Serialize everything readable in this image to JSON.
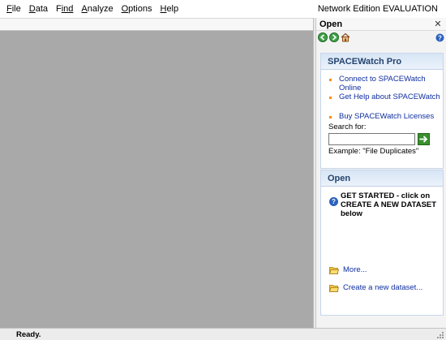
{
  "menubar": {
    "items": [
      {
        "key": "F",
        "rest": "ile"
      },
      {
        "key": "D",
        "rest": "ata"
      },
      {
        "key": "F",
        "rest": "ind"
      },
      {
        "key": "A",
        "rest": "nalyze"
      },
      {
        "key": "O",
        "rest": "ptions"
      },
      {
        "key": "H",
        "rest": "elp"
      }
    ],
    "edition": "Network Edition EVALUATION"
  },
  "panel": {
    "title": "Open",
    "close_glyph": "✕",
    "help_glyph": "?",
    "tools": [
      "back-icon",
      "forward-icon",
      "home-icon",
      "help-icon"
    ],
    "spacewatch": {
      "header": "SPACEWatch Pro",
      "links": [
        "Connect to SPACEWatch Online",
        "Get Help about SPACEWatch",
        "Buy SPACEWatch Licenses"
      ],
      "search_label": "Search for:",
      "search_value": "",
      "example": "Example: \"File Duplicates\""
    },
    "open_section": {
      "header": "Open",
      "get_started": "GET STARTED - click on CREATE A NEW DATASET below",
      "more": "More...",
      "create": "Create a new dataset..."
    }
  },
  "status": {
    "text": "Ready."
  },
  "colors": {
    "workspace": "#a9a9a9",
    "link": "#0f2ea0",
    "bullet": "#ff8c00",
    "go_button": "#3a8f2e",
    "card_header": "#25446e"
  }
}
